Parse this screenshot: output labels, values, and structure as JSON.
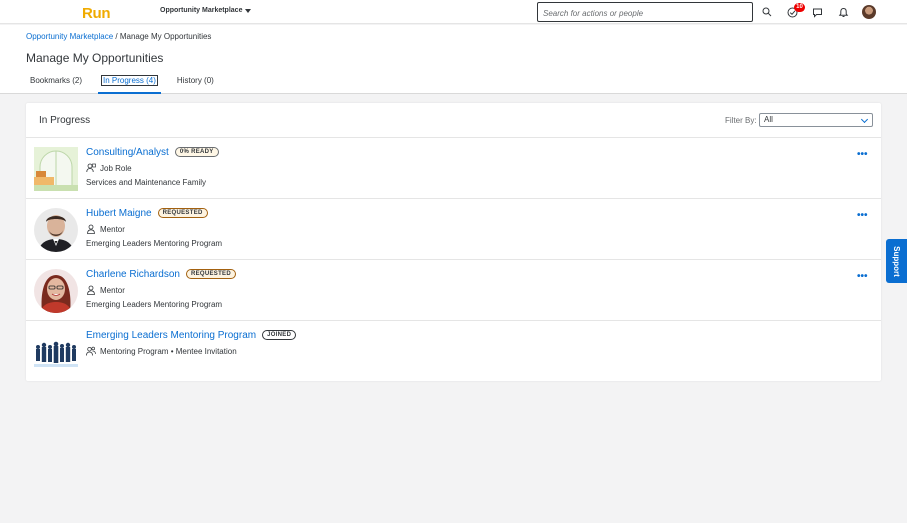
{
  "header": {
    "logo": "Run",
    "menu_label": "Opportunity Marketplace",
    "search_placeholder": "Search for actions or people",
    "notifications_badge": "10"
  },
  "breadcrumb": {
    "link": "Opportunity Marketplace",
    "separator": " / ",
    "current": "Manage My Opportunities"
  },
  "page_title": "Manage My Opportunities",
  "tabs": [
    {
      "label": "Bookmarks (2)",
      "active": false
    },
    {
      "label": "In Progress (4)",
      "active": true
    },
    {
      "label": "History (0)",
      "active": false
    }
  ],
  "section": {
    "title": "In Progress",
    "filter_label": "Filter By:",
    "filter_value": "All"
  },
  "items": [
    {
      "title": "Consulting/Analyst",
      "status": "0% READY",
      "type": "Job Role",
      "type_icon": "job-role-icon",
      "meta": "Services and Maintenance Family",
      "has_more": true
    },
    {
      "title": "Hubert Maigne",
      "status": "REQUESTED",
      "type": "Mentor",
      "type_icon": "person-icon",
      "meta": "Emerging Leaders Mentoring Program",
      "has_more": true
    },
    {
      "title": "Charlene Richardson",
      "status": "REQUESTED",
      "type": "Mentor",
      "type_icon": "person-icon",
      "meta": "Emerging Leaders Mentoring Program",
      "has_more": true
    },
    {
      "title": "Emerging Leaders Mentoring Program",
      "status": "JOINED",
      "type": "Mentoring Program • Mentee Invitation",
      "type_icon": "group-icon",
      "meta": "",
      "has_more": false
    }
  ],
  "more_label": "•••",
  "support_label": "Support",
  "colors": {
    "brand_link": "#0a6ed1",
    "logo": "#f0ab00",
    "badge": "#ee0000"
  }
}
